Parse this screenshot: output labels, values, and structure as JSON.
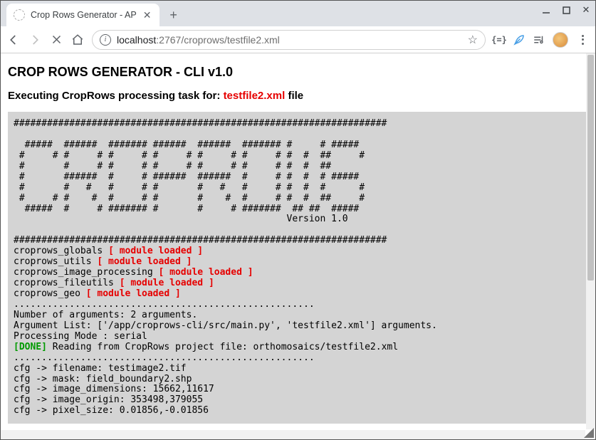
{
  "window": {
    "tab_title": "Crop Rows Generator - AP"
  },
  "omnibox": {
    "host": "localhost",
    "port": ":2767",
    "path": "/croprows/testfile2.xml"
  },
  "ext": {
    "braces": "{=}"
  },
  "page": {
    "h1": "CROP ROWS GENERATOR - CLI v1.0",
    "h2_prefix": "Executing CropRows processing task for: ",
    "h2_filename": "testfile2.xml",
    "h2_suffix": " file",
    "hr": "###################################################################",
    "ascii": [
      "  #####  ######  ####### ######  ######  ####### #     # #####",
      " #     # #     # #     # #     # #     # #     # #  #  ##     #",
      " #       #     # #     # #     # #     # #     # #  #  ##",
      " #       ######  #     # ######  ######  #     # #  #  # #####",
      " #       #   #   #     # #       #   #   #     # #  #  #      #",
      " #     # #    #  #     # #       #    #  #     # #  #  ##     #",
      "  #####  #     # ####### #       #     # #######  ## ##  #####",
      "                                                 Version 1.0"
    ],
    "modules": [
      {
        "name": "croprows_globals",
        "status": "[ module loaded ]"
      },
      {
        "name": "croprows_utils",
        "status": "[ module loaded ]"
      },
      {
        "name": "croprows_image_processing",
        "status": "[ module loaded ]"
      },
      {
        "name": "croprows_fileutils",
        "status": "[ module loaded ]"
      },
      {
        "name": "croprows_geo",
        "status": "[ module loaded ]"
      }
    ],
    "dots": "......................................................",
    "args_count": "Number of arguments: 2 arguments.",
    "args_list": "Argument List: ['/app/croprows-cli/src/main.py', 'testfile2.xml'] arguments.",
    "mode": "Processing Mode : serial",
    "done_tag": "[DONE]",
    "done_msg": " Reading from CropRows project file: orthomosaics/testfile2.xml",
    "cfg": [
      "cfg -> filename: testimage2.tif",
      "cfg -> mask: field_boundary2.shp",
      "cfg -> image_dimensions: 15662,11617",
      "cfg -> image_origin: 353498,379055",
      "cfg -> pixel_size: 0.01856,-0.01856"
    ]
  }
}
